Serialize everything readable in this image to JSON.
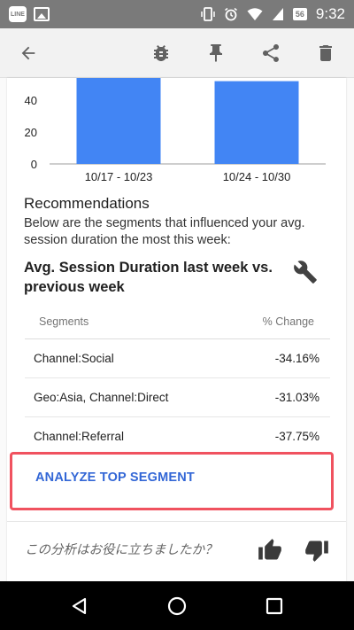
{
  "status_bar": {
    "app_icon_label": "LINE",
    "battery_level": "56",
    "time": "9:32"
  },
  "chart_data": {
    "type": "bar",
    "categories": [
      "10/17 - 10/23",
      "10/24 - 10/30"
    ],
    "values": [
      54,
      52
    ],
    "y_ticks": [
      "0",
      "20",
      "40"
    ],
    "ylim": [
      0,
      54
    ],
    "bar_color": "#4285f4",
    "grid": false
  },
  "recommendations": {
    "title": "Recommendations",
    "description": "Below are the segments that influenced your avg. session duration the most this week:"
  },
  "insight": {
    "title": "Avg. Session Duration last week vs. previous week",
    "icon": "wrench-icon"
  },
  "table": {
    "headers": {
      "segment": "Segments",
      "change": "% Change"
    },
    "rows": [
      {
        "segment": "Channel:Social",
        "change": "-34.16%"
      },
      {
        "segment": "Geo:Asia, Channel:Direct",
        "change": "-31.03%"
      },
      {
        "segment": "Channel:Referral",
        "change": "-37.75%"
      }
    ]
  },
  "actions": {
    "analyze_label": "ANALYZE TOP SEGMENT",
    "highlight_color": "#f0525f"
  },
  "feedback": {
    "question": "この分析はお役に立ちましたか？"
  },
  "colors": {
    "accent": "#3367d6",
    "status_bar": "#7a7a7a"
  }
}
